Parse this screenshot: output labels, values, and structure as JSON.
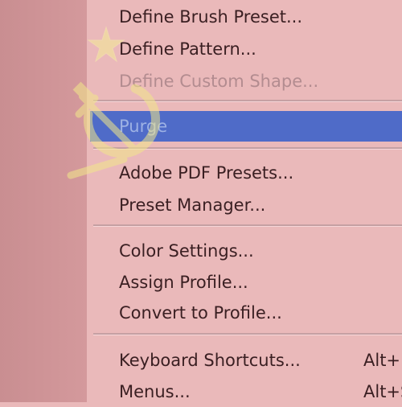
{
  "menu": {
    "items": [
      {
        "label": "Define Brush Preset...",
        "shortcut": "",
        "state": "normal"
      },
      {
        "label": "Define Pattern...",
        "shortcut": "",
        "state": "normal"
      },
      {
        "label": "Define Custom Shape...",
        "shortcut": "",
        "state": "disabled"
      },
      {
        "label": "Purge",
        "shortcut": "",
        "state": "highlighted"
      },
      {
        "label": "Adobe PDF Presets...",
        "shortcut": "",
        "state": "normal"
      },
      {
        "label": "Preset Manager...",
        "shortcut": "",
        "state": "normal"
      },
      {
        "label": "Color Settings...",
        "shortcut": "",
        "state": "normal"
      },
      {
        "label": "Assign Profile...",
        "shortcut": "",
        "state": "normal"
      },
      {
        "label": "Convert to Profile...",
        "shortcut": "",
        "state": "normal"
      },
      {
        "label": "Keyboard Shortcuts...",
        "shortcut": "Alt+",
        "state": "normal"
      },
      {
        "label": "Menus...",
        "shortcut": "Alt+S",
        "state": "normal"
      }
    ]
  },
  "colors": {
    "menu_background": "#eab9ba",
    "highlight": "#4f6bc8",
    "disabled_text": "#b38c90",
    "text": "#3a1f22",
    "left_panel": "#c98e91",
    "emblem": "#f2e88a"
  },
  "icons": {
    "emblem": "hammer-and-sickle-star-icon"
  }
}
